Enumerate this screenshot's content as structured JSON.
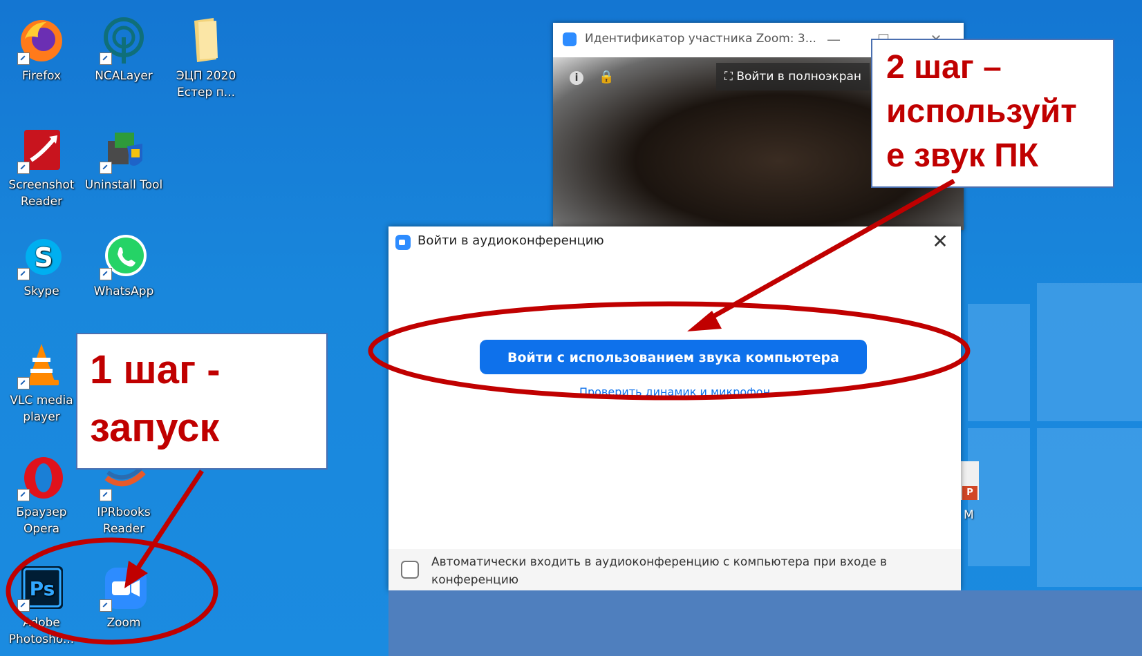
{
  "desktop": {
    "icons": [
      {
        "label": "Firefox",
        "icon": "firefox-icon"
      },
      {
        "label": "NCALayer",
        "icon": "ncalayer-icon"
      },
      {
        "label": "ЭЦП 2020 Естер п...",
        "icon": "folder-icon"
      },
      {
        "label": "Screenshot Reader",
        "icon": "screenshot-reader-icon"
      },
      {
        "label": "Uninstall Tool",
        "icon": "uninstall-tool-icon"
      },
      {
        "label": "Skype",
        "icon": "skype-icon"
      },
      {
        "label": "WhatsApp",
        "icon": "whatsapp-icon"
      },
      {
        "label": "VLC media player",
        "icon": "vlc-icon"
      },
      {
        "label": "Браузер Opera",
        "icon": "opera-icon"
      },
      {
        "label": "IPRbooks Reader",
        "icon": "iprbooks-icon"
      },
      {
        "label": "Adobe Photosho...",
        "icon": "photoshop-icon"
      },
      {
        "label": "Zoom",
        "icon": "zoom-icon"
      }
    ],
    "partial_label": "M"
  },
  "video_window": {
    "title": "Идентификатор участника Zoom: 3...",
    "fullscreen_label": "Войти в полноэкран"
  },
  "audio_dialog": {
    "title": "Войти в аудиоконференцию",
    "join_button": "Войти с использованием звука компьютера",
    "test_link": "Проверить динамик и микрофон",
    "auto_join_text": "Автоматически входить в аудиоконференцию с компьютера при входе в конференцию",
    "auto_join_checked": false
  },
  "annotations": {
    "step1_line1": "1 шаг -",
    "step1_line2": "запуск",
    "step2_line1": "2 шаг –",
    "step2_line2": "используйт",
    "step2_line3": "е звук ПК",
    "color": "#c00000"
  }
}
